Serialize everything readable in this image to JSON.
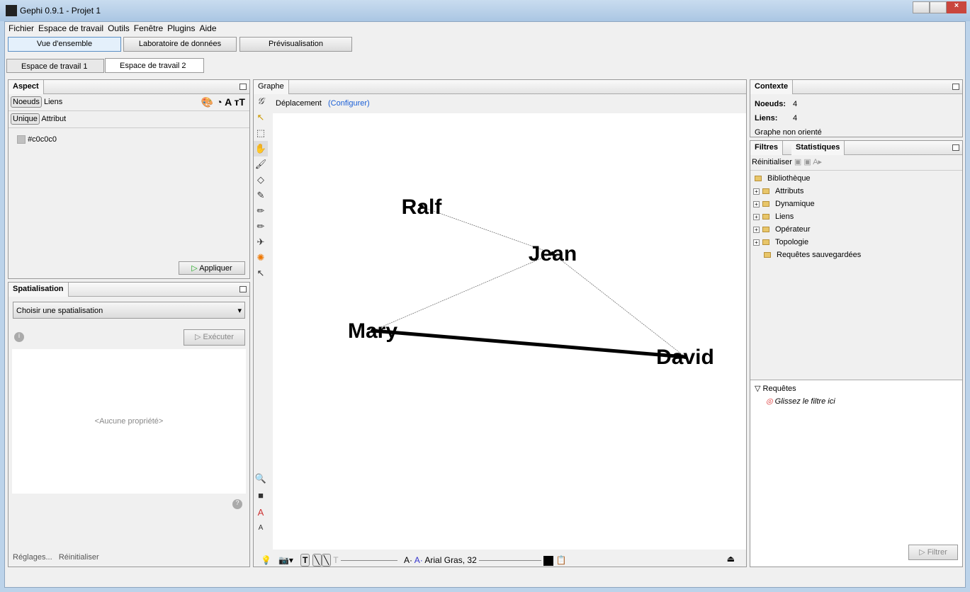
{
  "window": {
    "title": "Gephi 0.9.1 - Projet 1"
  },
  "menu": [
    "Fichier",
    "Espace de travail",
    "Outils",
    "Fenêtre",
    "Plugins",
    "Aide"
  ],
  "modes": [
    "Vue d'ensemble",
    "Laboratoire de données",
    "Prévisualisation"
  ],
  "workspaces": [
    "Espace de travail 1",
    "Espace de travail 2"
  ],
  "aspect": {
    "title": "Aspect",
    "tabs": [
      "Noeuds",
      "Liens"
    ],
    "subtabs": [
      "Unique",
      "Attribut"
    ],
    "color": "#c0c0c0",
    "apply": "Appliquer"
  },
  "spatial": {
    "title": "Spatialisation",
    "select": "Choisir une spatialisation",
    "run": "Exécuter",
    "empty": "<Aucune propriété>",
    "settings": "Réglages...",
    "reset": "Réinitialiser"
  },
  "graph": {
    "tab": "Graphe",
    "tool": "Déplacement",
    "configure": "(Configurer)",
    "font": "Arial Gras, 32",
    "nodes": [
      "Ralf",
      "Jean",
      "Mary",
      "David"
    ],
    "edges": [
      [
        "Ralf",
        "Jean",
        1
      ],
      [
        "Jean",
        "Mary",
        1
      ],
      [
        "Jean",
        "David",
        1
      ],
      [
        "Mary",
        "David",
        5
      ]
    ]
  },
  "context": {
    "title": "Contexte",
    "nodes_label": "Noeuds:",
    "nodes": "4",
    "edges_label": "Liens:",
    "edges": "4",
    "type": "Graphe non orienté"
  },
  "filters": {
    "tabs": [
      "Filtres",
      "Statistiques"
    ],
    "reset": "Réinitialiser",
    "library": "Bibliothèque",
    "items": [
      "Attributs",
      "Dynamique",
      "Liens",
      "Opérateur",
      "Topologie"
    ],
    "saved": "Requêtes sauvegardées",
    "queries": "Requêtes",
    "drop": "Glissez le filtre ici",
    "filter": "Filtrer"
  }
}
